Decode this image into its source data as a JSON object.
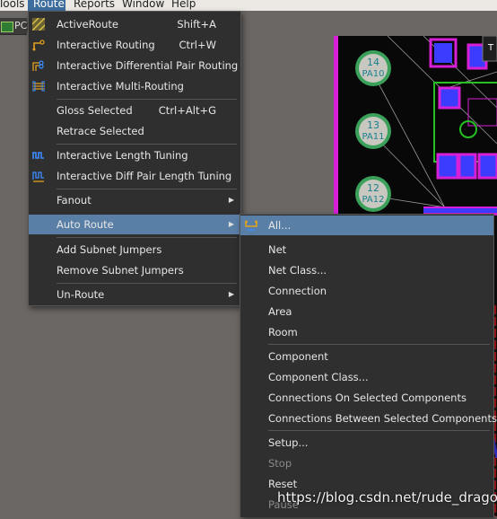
{
  "menubar": {
    "items": [
      "Tools",
      "Route",
      "Reports",
      "Window",
      "Help"
    ],
    "active": "Route"
  },
  "doc_tab": {
    "label": "PCB"
  },
  "route_menu": {
    "items": [
      {
        "label": "ActiveRoute",
        "shortcut": "Shift+A",
        "icon": "active-route-icon"
      },
      {
        "label": "Interactive Routing",
        "shortcut": "Ctrl+W",
        "icon": "interactive-routing-icon"
      },
      {
        "label": "Interactive Differential Pair Routing",
        "shortcut": "",
        "icon": "diff-pair-routing-icon"
      },
      {
        "label": "Interactive Multi-Routing",
        "shortcut": "",
        "icon": "multi-routing-icon"
      },
      {
        "label": "Gloss Selected",
        "shortcut": "Ctrl+Alt+G"
      },
      {
        "label": "Retrace Selected",
        "shortcut": ""
      },
      {
        "label": "Interactive Length Tuning",
        "shortcut": "",
        "icon": "length-tuning-icon"
      },
      {
        "label": "Interactive Diff Pair Length Tuning",
        "shortcut": "",
        "icon": "diff-pair-length-tuning-icon"
      },
      {
        "label": "Fanout",
        "shortcut": "",
        "submenu": true
      },
      {
        "label": "Auto Route",
        "shortcut": "",
        "submenu": true,
        "highlighted": true
      },
      {
        "label": "Add Subnet Jumpers",
        "shortcut": ""
      },
      {
        "label": "Remove Subnet Jumpers",
        "shortcut": ""
      },
      {
        "label": "Un-Route",
        "shortcut": "",
        "submenu": true
      }
    ]
  },
  "autoroute_menu": {
    "items": [
      {
        "label": "All...",
        "highlighted": true,
        "icon": "autoroute-all-icon"
      },
      {
        "label": "Net"
      },
      {
        "label": "Net Class..."
      },
      {
        "label": "Connection"
      },
      {
        "label": "Area"
      },
      {
        "label": "Room"
      },
      {
        "label": "Component"
      },
      {
        "label": "Component Class..."
      },
      {
        "label": "Connections On Selected Components"
      },
      {
        "label": "Connections Between Selected Components"
      },
      {
        "label": "Setup..."
      },
      {
        "label": "Stop",
        "disabled": true
      },
      {
        "label": "Reset"
      },
      {
        "label": "Pause",
        "disabled": true
      }
    ]
  },
  "pcb": {
    "pads": [
      {
        "num": "14",
        "name": "PA10"
      },
      {
        "num": "13",
        "name": "PA11"
      },
      {
        "num": "12",
        "name": "PA12"
      }
    ],
    "corner_label": "T"
  },
  "watermark": "https://blog.csdn.net/rude_dragon",
  "colors": {
    "menu_bg": "#2f2f2f",
    "highlight": "#5a7fa6",
    "menubar_active": "#3d6e9d",
    "pad_fill": "#c8c8c0",
    "pad_text": "#1a7f8f",
    "pcb_bg": "#080808",
    "magenta": "#d71fd7",
    "green": "#24c024",
    "blue": "#3c3cff",
    "red": "#d01818"
  }
}
